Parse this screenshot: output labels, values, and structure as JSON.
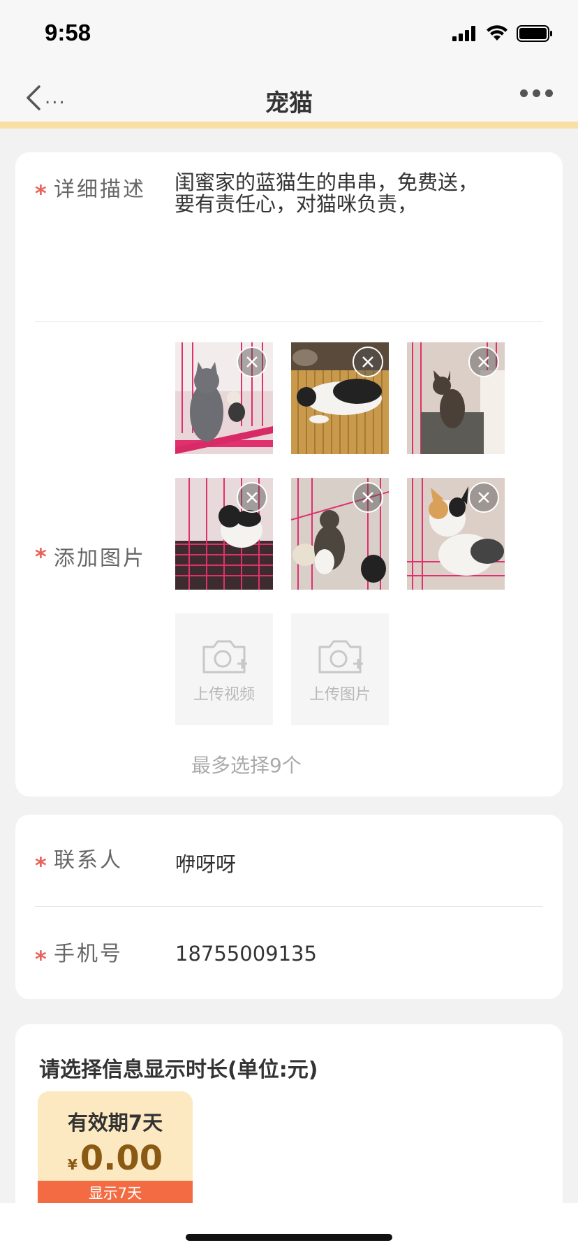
{
  "status": {
    "time": "9:58"
  },
  "nav": {
    "title": "宠猫",
    "back_dots": "..."
  },
  "description": {
    "label": "详细描述",
    "required_mark": "*",
    "value_line1": "闺蜜家的蓝猫生的串串，免费送，",
    "value_line2": "要有责任心，对猫咪负责，"
  },
  "images": {
    "label": "添加图片",
    "required_mark": "*",
    "photos": [
      {
        "name": "photo-1",
        "theme": "grey cat in pink cage"
      },
      {
        "name": "photo-2",
        "theme": "black and white kitten on mat"
      },
      {
        "name": "photo-3",
        "theme": "tabby kitten in cage"
      },
      {
        "name": "photo-4",
        "theme": "black and white kitten in cage"
      },
      {
        "name": "photo-5",
        "theme": "tabby kittens in cage"
      },
      {
        "name": "photo-6",
        "theme": "calico kitten in cage"
      }
    ],
    "upload_video_label": "上传视频",
    "upload_image_label": "上传图片",
    "max_hint": "最多选择9个"
  },
  "contact": {
    "label": "联系人",
    "required_mark": "*",
    "value": "咿呀呀"
  },
  "phone": {
    "label": "手机号",
    "required_mark": "*",
    "value": "18755009135"
  },
  "duration": {
    "title": "请选择信息显示时长(单位:元)",
    "option": {
      "period": "有效期7天",
      "currency": "¥",
      "amount": "0.00",
      "badge": "显示7天"
    }
  },
  "colors": {
    "accent": "#f9dfa5",
    "required": "#e8625a",
    "price_card_bg": "#fde9c1",
    "badge": "#f26b43"
  }
}
